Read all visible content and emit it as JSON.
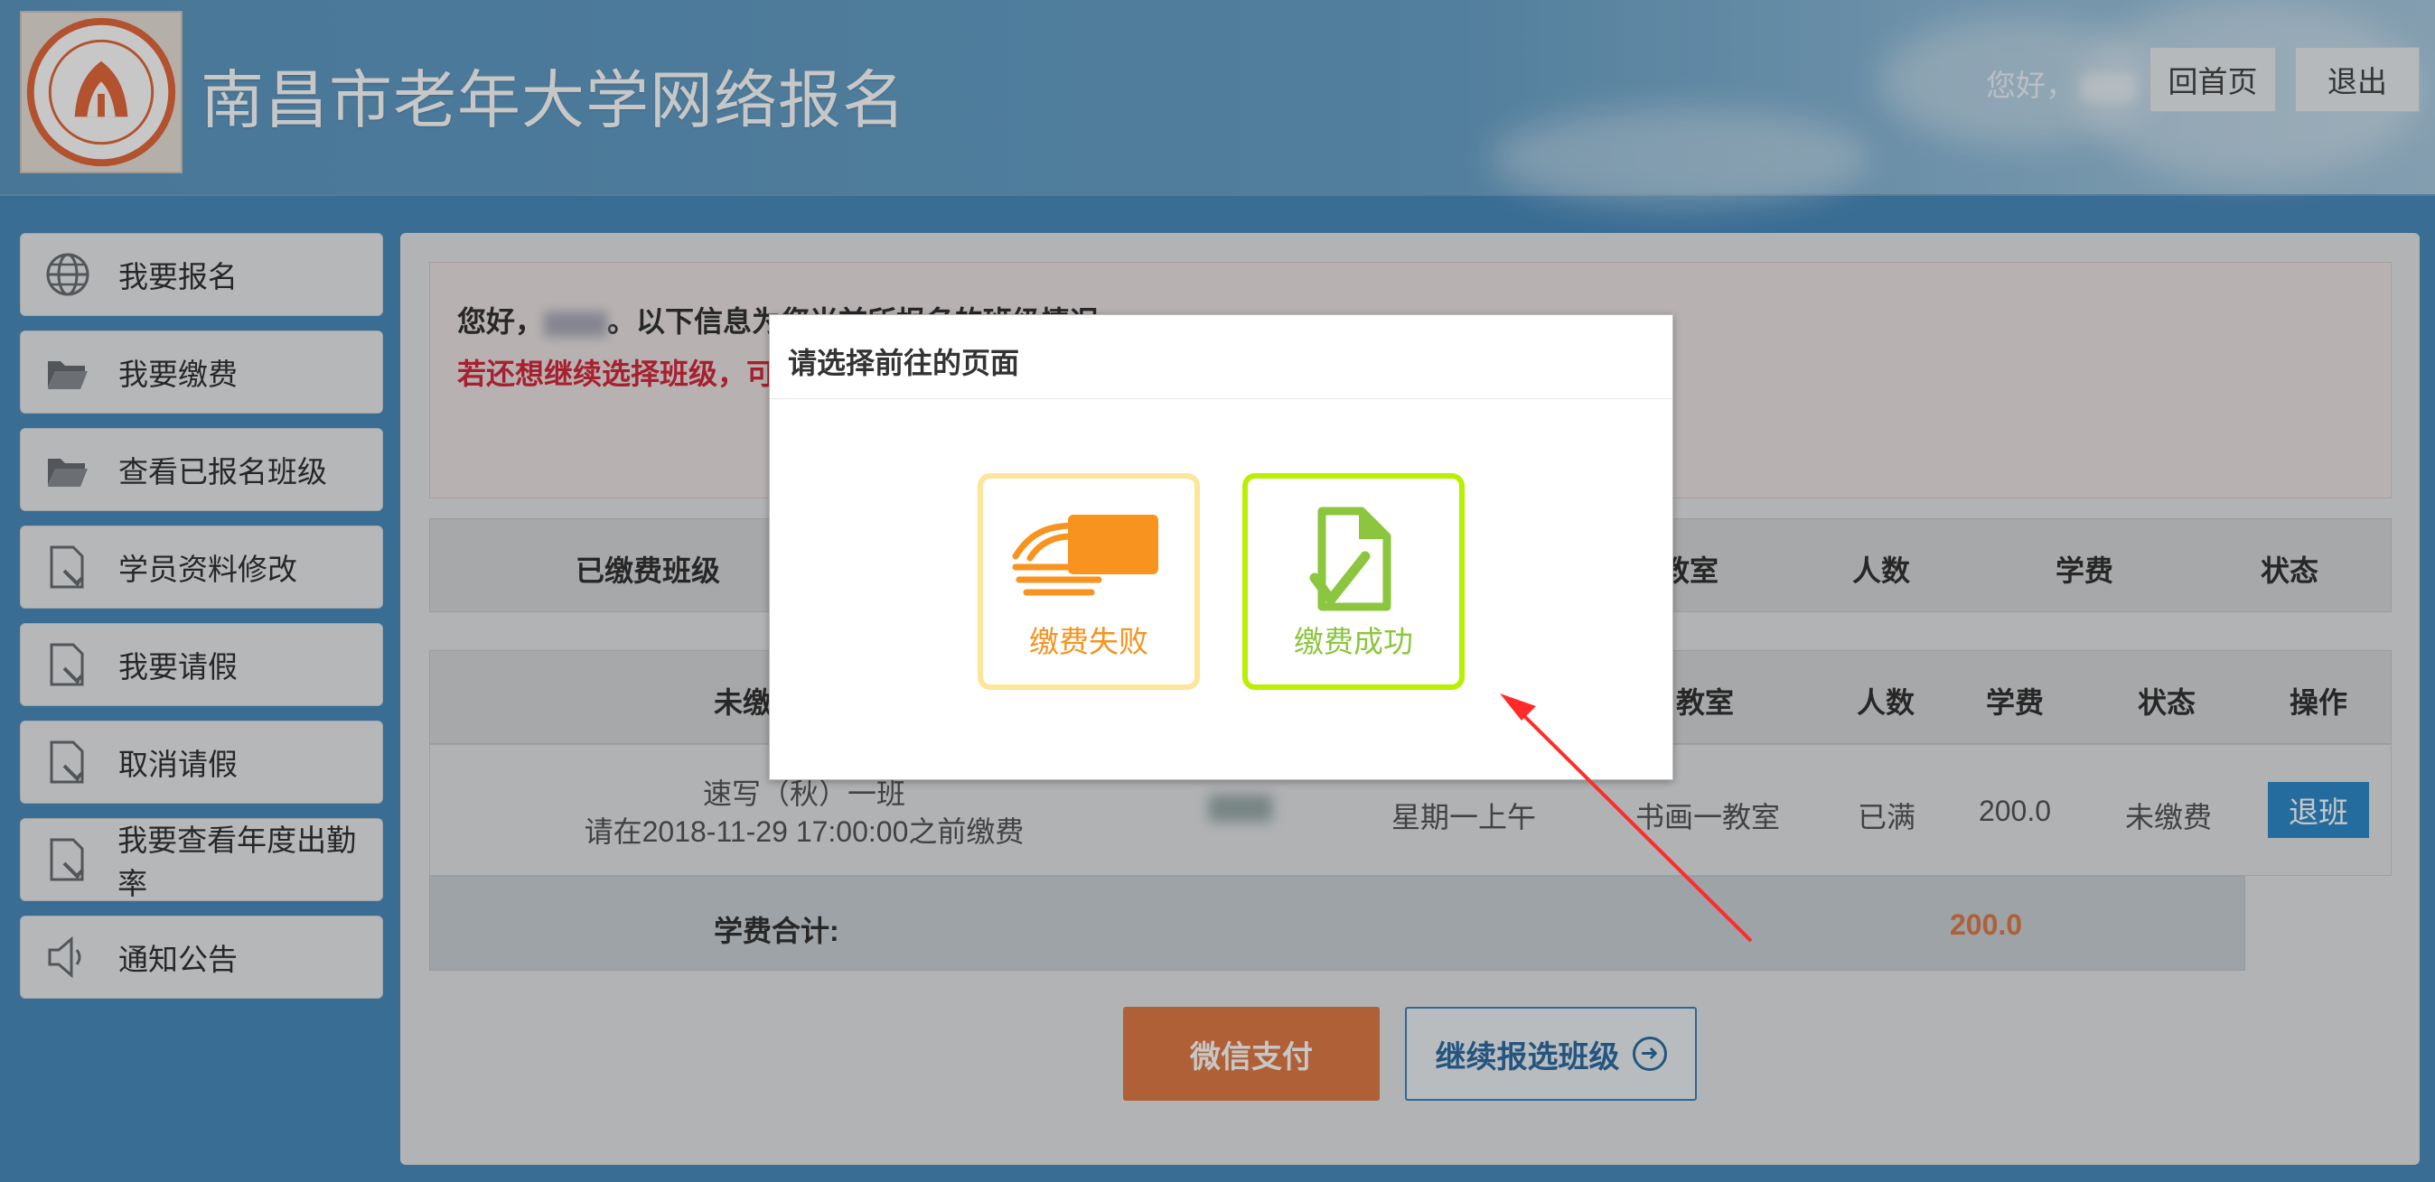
{
  "header": {
    "site_title": "南昌市老年大学网络报名",
    "greeting": "您好，",
    "home_button": "回首页",
    "logout_button": "退出"
  },
  "sidebar": {
    "items": [
      {
        "label": "我要报名",
        "icon": "globe-icon"
      },
      {
        "label": "我要缴费",
        "icon": "folder-open-icon"
      },
      {
        "label": "查看已报名班级",
        "icon": "folder-open-icon"
      },
      {
        "label": "学员资料修改",
        "icon": "document-edit-icon"
      },
      {
        "label": "我要请假",
        "icon": "document-edit-icon"
      },
      {
        "label": "取消请假",
        "icon": "document-edit-icon"
      },
      {
        "label": "我要查看年度出勤率",
        "icon": "document-edit-icon"
      },
      {
        "label": "通知公告",
        "icon": "speaker-icon"
      }
    ]
  },
  "notice": {
    "line1_prefix": "您好，",
    "line1_suffix": "。以下信息为您当前所报名的班级情况",
    "line2": "若还想继续选择班级，可"
  },
  "paid_table": {
    "headers": [
      "已缴费班级",
      "教室",
      "人数",
      "学费",
      "状态"
    ]
  },
  "unpaid_table": {
    "headers": [
      "未缴",
      "教室",
      "人数",
      "学费",
      "状态",
      "操作"
    ],
    "rows": [
      {
        "class_name": "速写（秋）一班",
        "deadline": "请在2018-11-29 17:00:00之前缴费",
        "time": "星期一上午",
        "room": "书画一教室",
        "count": "已满",
        "fee": "200.0",
        "status": "未缴费",
        "action": "退班"
      }
    ],
    "total_label": "学费合计:",
    "total_value": "200.0"
  },
  "actions": {
    "wechat_pay": "微信支付",
    "continue_select": "继续报选班级"
  },
  "modal": {
    "title": "请选择前往的页面",
    "fail_label": "缴费失败",
    "success_label": "缴费成功"
  },
  "colors": {
    "fail_orange": "#f7931e",
    "success_green": "#8bc63e",
    "alert_red": "#d7293e",
    "fee_orange": "#e07b47",
    "annotation_arrow": "#ff2b2b"
  }
}
